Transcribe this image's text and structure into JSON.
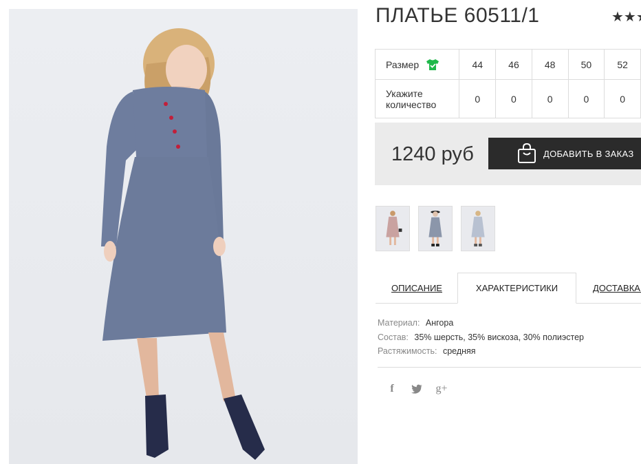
{
  "product": {
    "title": "ПЛАТЬЕ 60511/1",
    "rating_stars": "★★★"
  },
  "sizes": {
    "size_label": "Размер",
    "qty_label": "Укажите количество",
    "values": [
      "44",
      "46",
      "48",
      "50",
      "52"
    ],
    "quantities": [
      "0",
      "0",
      "0",
      "0",
      "0"
    ]
  },
  "purchase": {
    "price": "1240 руб",
    "add_button": "ДОБАВИТЬ В ЗАКАЗ"
  },
  "tabs": {
    "description": "ОПИСАНИЕ",
    "characteristics": "ХАРАКТЕРИСТИКИ",
    "delivery": "ДОСТАВКА И"
  },
  "specs": [
    {
      "label": "Материал:",
      "value": "Ангора"
    },
    {
      "label": "Состав:",
      "value": "35% шерсть, 35% вискоза, 30% полиэстер"
    },
    {
      "label": "Растяжимость:",
      "value": "средняя"
    }
  ],
  "social": {
    "facebook": "f",
    "twitter": "🐦",
    "googleplus": "g+"
  },
  "colors": {
    "button": "#2b2b2b",
    "price_bg": "#ebebeb",
    "size_icon": "#1fb84a",
    "dress": "#6e7d9e"
  }
}
